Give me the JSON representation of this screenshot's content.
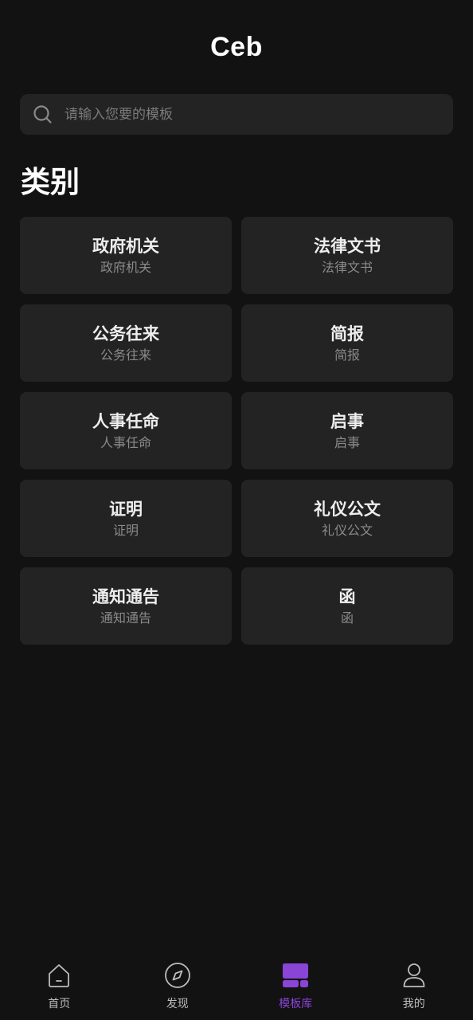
{
  "header": {
    "title": "Ceb"
  },
  "search": {
    "placeholder": "请输入您要的模板",
    "value": ""
  },
  "section": {
    "title": "类别"
  },
  "categories": [
    {
      "title": "政府机关",
      "subtitle": "政府机关"
    },
    {
      "title": "法律文书",
      "subtitle": "法律文书"
    },
    {
      "title": "公务往来",
      "subtitle": "公务往来"
    },
    {
      "title": "简报",
      "subtitle": "简报"
    },
    {
      "title": "人事任命",
      "subtitle": "人事任命"
    },
    {
      "title": "启事",
      "subtitle": "启事"
    },
    {
      "title": "证明",
      "subtitle": "证明"
    },
    {
      "title": "礼仪公文",
      "subtitle": "礼仪公文"
    },
    {
      "title": "通知通告",
      "subtitle": "通知通告"
    },
    {
      "title": "函",
      "subtitle": "函"
    }
  ],
  "tabbar": {
    "items": [
      {
        "label": "首页",
        "icon": "home-icon",
        "active": false
      },
      {
        "label": "发现",
        "icon": "compass-icon",
        "active": false
      },
      {
        "label": "模板库",
        "icon": "template-library-icon",
        "active": true
      },
      {
        "label": "我的",
        "icon": "user-icon",
        "active": false
      }
    ],
    "active_color": "#8a44d6",
    "inactive_color": "#bdbdbd"
  },
  "colors": {
    "background": "#121212",
    "card": "#232323",
    "accent": "#8a44d6"
  }
}
